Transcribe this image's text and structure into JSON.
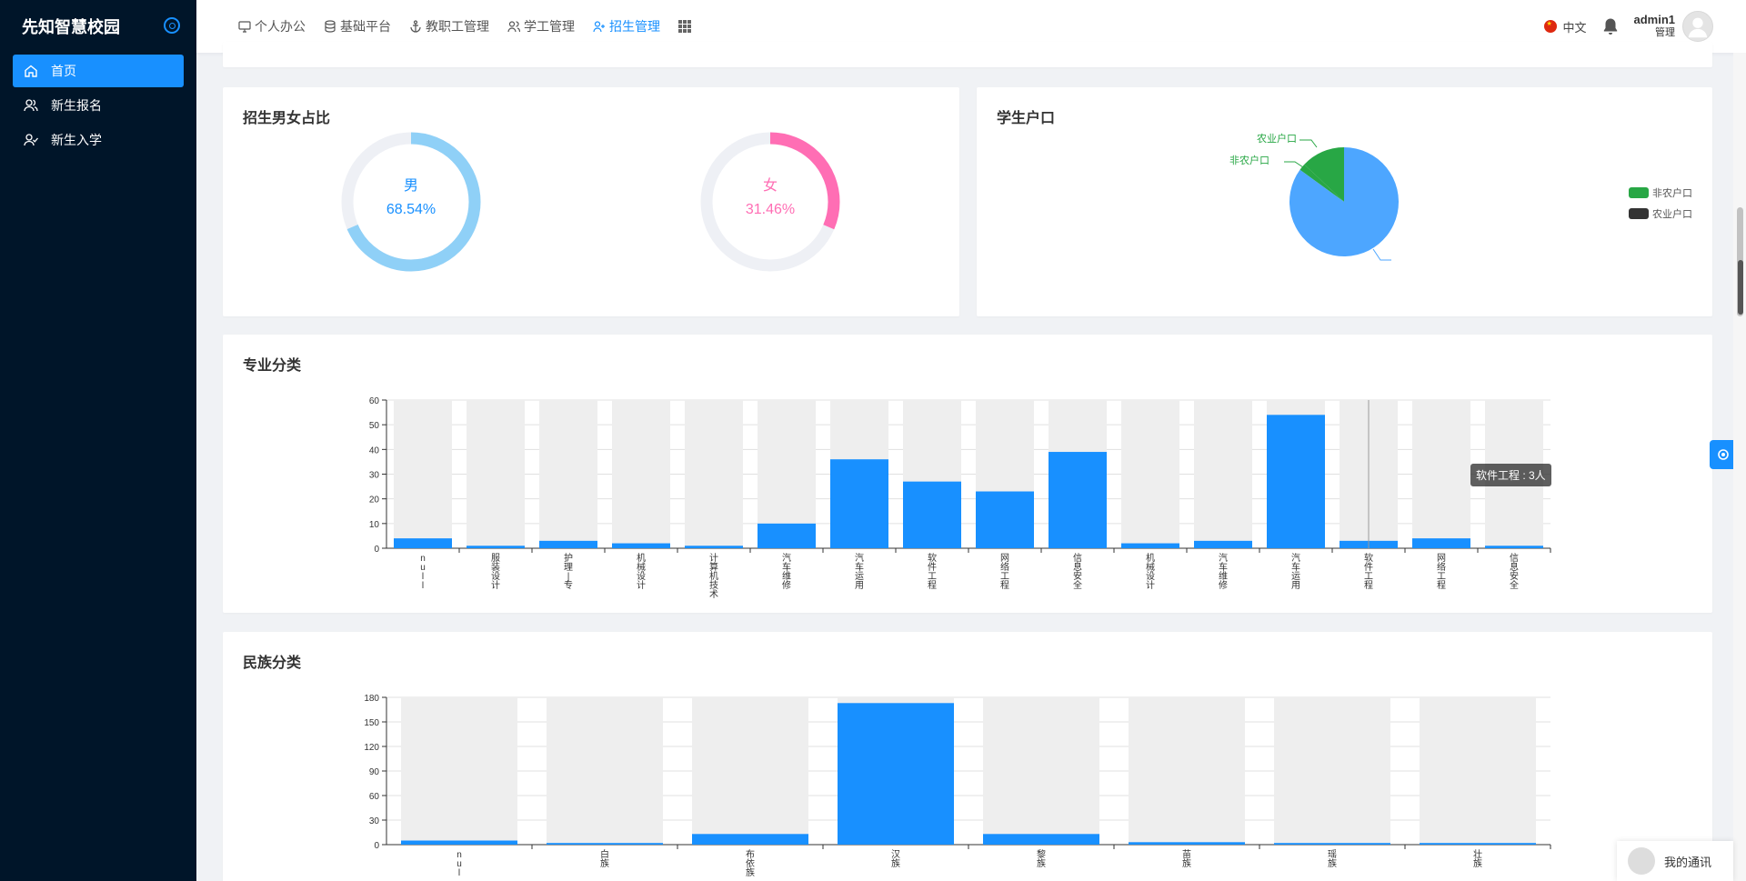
{
  "app": {
    "title": "先知智慧校园"
  },
  "sidebar": {
    "items": [
      {
        "label": "首页",
        "icon": "home-icon",
        "active": true
      },
      {
        "label": "新生报名",
        "icon": "users-icon",
        "active": false
      },
      {
        "label": "新生入学",
        "icon": "user-check-icon",
        "active": false
      }
    ]
  },
  "header": {
    "nav": [
      {
        "label": "个人办公",
        "icon": "monitor-icon"
      },
      {
        "label": "基础平台",
        "icon": "database-icon"
      },
      {
        "label": "教职工管理",
        "icon": "anchor-icon"
      },
      {
        "label": "学工管理",
        "icon": "users-icon"
      },
      {
        "label": "招生管理",
        "icon": "user-plus-icon",
        "active": true
      }
    ],
    "language": "中文",
    "user_name": "admin1",
    "user_role": "管理"
  },
  "gender_card": {
    "title": "招生男女占比",
    "male": {
      "label": "男",
      "percent_text": "68.54%",
      "value": 68.54,
      "color": "#8fd0f7"
    },
    "female": {
      "label": "女",
      "percent_text": "31.46%",
      "value": 31.46,
      "color": "#ff6eb4"
    }
  },
  "hukou_card": {
    "title": "学生户口",
    "legend": [
      {
        "label": "非农户口",
        "color": "#28a745"
      },
      {
        "label": "农业户口",
        "color": "#333333"
      }
    ],
    "chart_data": {
      "type": "pie",
      "labels": [
        "农业户口",
        "非农户口",
        ""
      ],
      "values": [
        2,
        13,
        85
      ],
      "colors": [
        "#28a745",
        "#28a745",
        "#4da6ff"
      ]
    }
  },
  "major_card": {
    "title": "专业分类",
    "tooltip": "软件工程 : 3人",
    "chart_data": {
      "type": "bar",
      "categories": [
        "null",
        "服装设计",
        "护理专",
        "机械设计",
        "计算机技术",
        "汽车维修",
        "汽车运用",
        "软件工程",
        "网络工程",
        "信息安全",
        "机械设计",
        "汽车维修",
        "汽车运用",
        "软件工程",
        "网络工程",
        "信息安全"
      ],
      "tick_labels": [
        "n u l l",
        "服装设计",
        "护理 | 专",
        "机械设计",
        "计算机技术",
        "汽车维修",
        "汽车运用",
        "软件工程",
        "网络工程",
        "信息安全",
        "机械设计",
        "汽车维修",
        "汽车运用",
        "软件工程",
        "网络工程",
        "信息安全"
      ],
      "values": [
        4,
        1,
        3,
        2,
        1,
        10,
        36,
        27,
        23,
        39,
        2,
        3,
        54,
        3,
        4,
        1
      ],
      "ylim": [
        0,
        60
      ],
      "yticks": [
        0,
        10,
        20,
        30,
        40,
        50,
        60
      ],
      "bar_color": "#1890ff",
      "shadow_color": "#eeeeee"
    }
  },
  "ethnic_card": {
    "title": "民族分类",
    "chart_data": {
      "type": "bar",
      "categories": [
        "null",
        "白族",
        "布依族",
        "汉族",
        "黎族",
        "苗族",
        "瑶族",
        "壮族"
      ],
      "tick_labels": [
        "n u l",
        "白 族",
        "布 依 族",
        "汉 族",
        "黎 族",
        "苗 族",
        "瑶 族",
        "壮 族"
      ],
      "values": [
        5,
        2,
        13,
        173,
        13,
        3,
        2,
        2
      ],
      "ylim": [
        0,
        180
      ],
      "yticks": [
        0,
        30,
        60,
        90,
        120,
        150,
        180
      ],
      "bar_color": "#1890ff",
      "shadow_color": "#eeeeee"
    }
  },
  "chat_widget": {
    "label": "我的通讯"
  }
}
